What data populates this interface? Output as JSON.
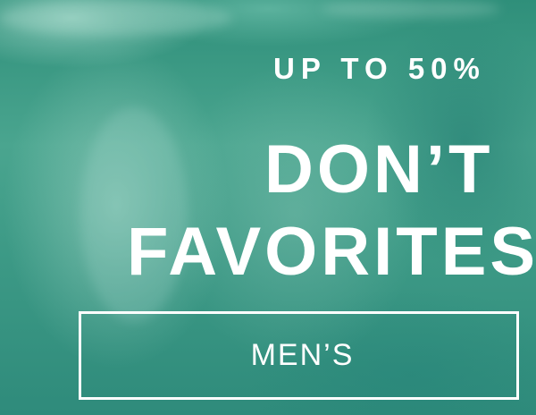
{
  "banner": {
    "eyebrow": "UP TO 50%",
    "headline_line1": "DON’T",
    "headline_line2": "FAVORITES",
    "cta_label": "MEN’S"
  }
}
